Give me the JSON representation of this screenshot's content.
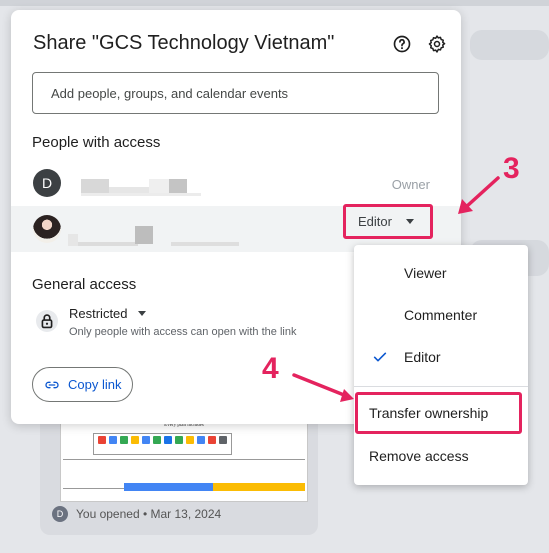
{
  "dialog": {
    "title": "Share \"GCS Technology Vietnam\"",
    "add_placeholder": "Add people, groups, and calendar events",
    "people_heading": "People with access",
    "people": [
      {
        "initial": "D",
        "role": "Owner"
      },
      {
        "role": "Editor"
      }
    ],
    "general_access_heading": "General access",
    "access_level": "Restricted",
    "access_description": "Only people with access can open with the link",
    "copy_link_label": "Copy link"
  },
  "role_menu": {
    "items": [
      "Viewer",
      "Commenter",
      "Editor",
      "Transfer ownership",
      "Remove access"
    ],
    "selected": "Editor"
  },
  "annotations": {
    "step3": "3",
    "step4": "4",
    "color": "#e4235e"
  },
  "background": {
    "opened_initial": "D",
    "opened_text": "You opened • Mar 13, 2024",
    "thumbnail_title": "Every plan includes"
  },
  "colors": {
    "accent": "#0b57d0",
    "highlight": "#e4235e"
  }
}
